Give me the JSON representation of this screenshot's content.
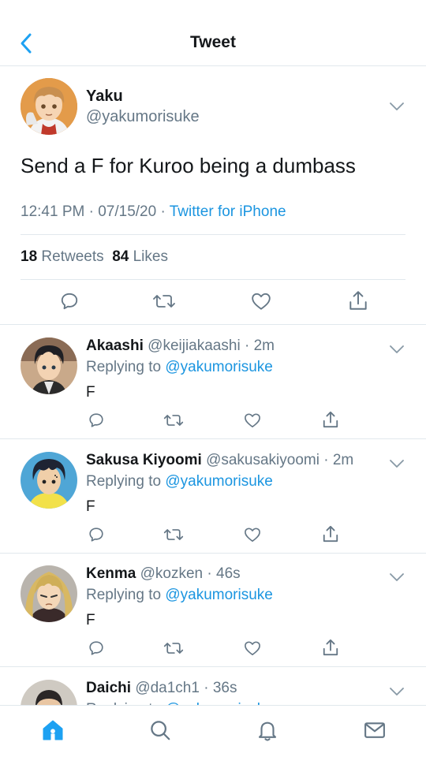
{
  "header": {
    "title": "Tweet"
  },
  "main_tweet": {
    "name": "Yaku",
    "handle": "@yakumorisuke",
    "text": "Send a F for Kuroo being a dumbass",
    "time": "12:41 PM",
    "date": "07/15/20",
    "source": "Twitter for iPhone",
    "retweets_count": "18",
    "retweets_label": "Retweets",
    "likes_count": "84",
    "likes_label": "Likes"
  },
  "replies": [
    {
      "name": "Akaashi",
      "handle": "@keijiakaashi",
      "time": "2m",
      "replying_label": "Replying to",
      "replying_to": "@yakumorisuke",
      "text": "F"
    },
    {
      "name": "Sakusa Kiyoomi",
      "handle": "@sakusakiyoomi",
      "time": "2m",
      "replying_label": "Replying to",
      "replying_to": "@yakumorisuke",
      "text": "F"
    },
    {
      "name": "Kenma",
      "handle": "@kozken",
      "time": "46s",
      "replying_label": "Replying to",
      "replying_to": "@yakumorisuke",
      "text": "F"
    },
    {
      "name": "Daichi",
      "handle": "@da1ch1",
      "time": "36s",
      "replying_label": "Replying to",
      "replying_to": "@yakumorisuke",
      "text": ""
    }
  ],
  "icons": {
    "back": "chevron-left-icon",
    "reply": "comment-icon",
    "retweet": "retweet-icon",
    "like": "heart-icon",
    "share": "share-icon",
    "more": "chevron-down-icon",
    "tabs": [
      "home-icon",
      "search-icon",
      "bell-icon",
      "mail-icon"
    ]
  },
  "colors": {
    "accent": "#1da1f2",
    "link": "#1b95e0",
    "secondary_text": "#657786",
    "divider": "#e1e8ed"
  },
  "tabbar": {
    "active": "home"
  }
}
